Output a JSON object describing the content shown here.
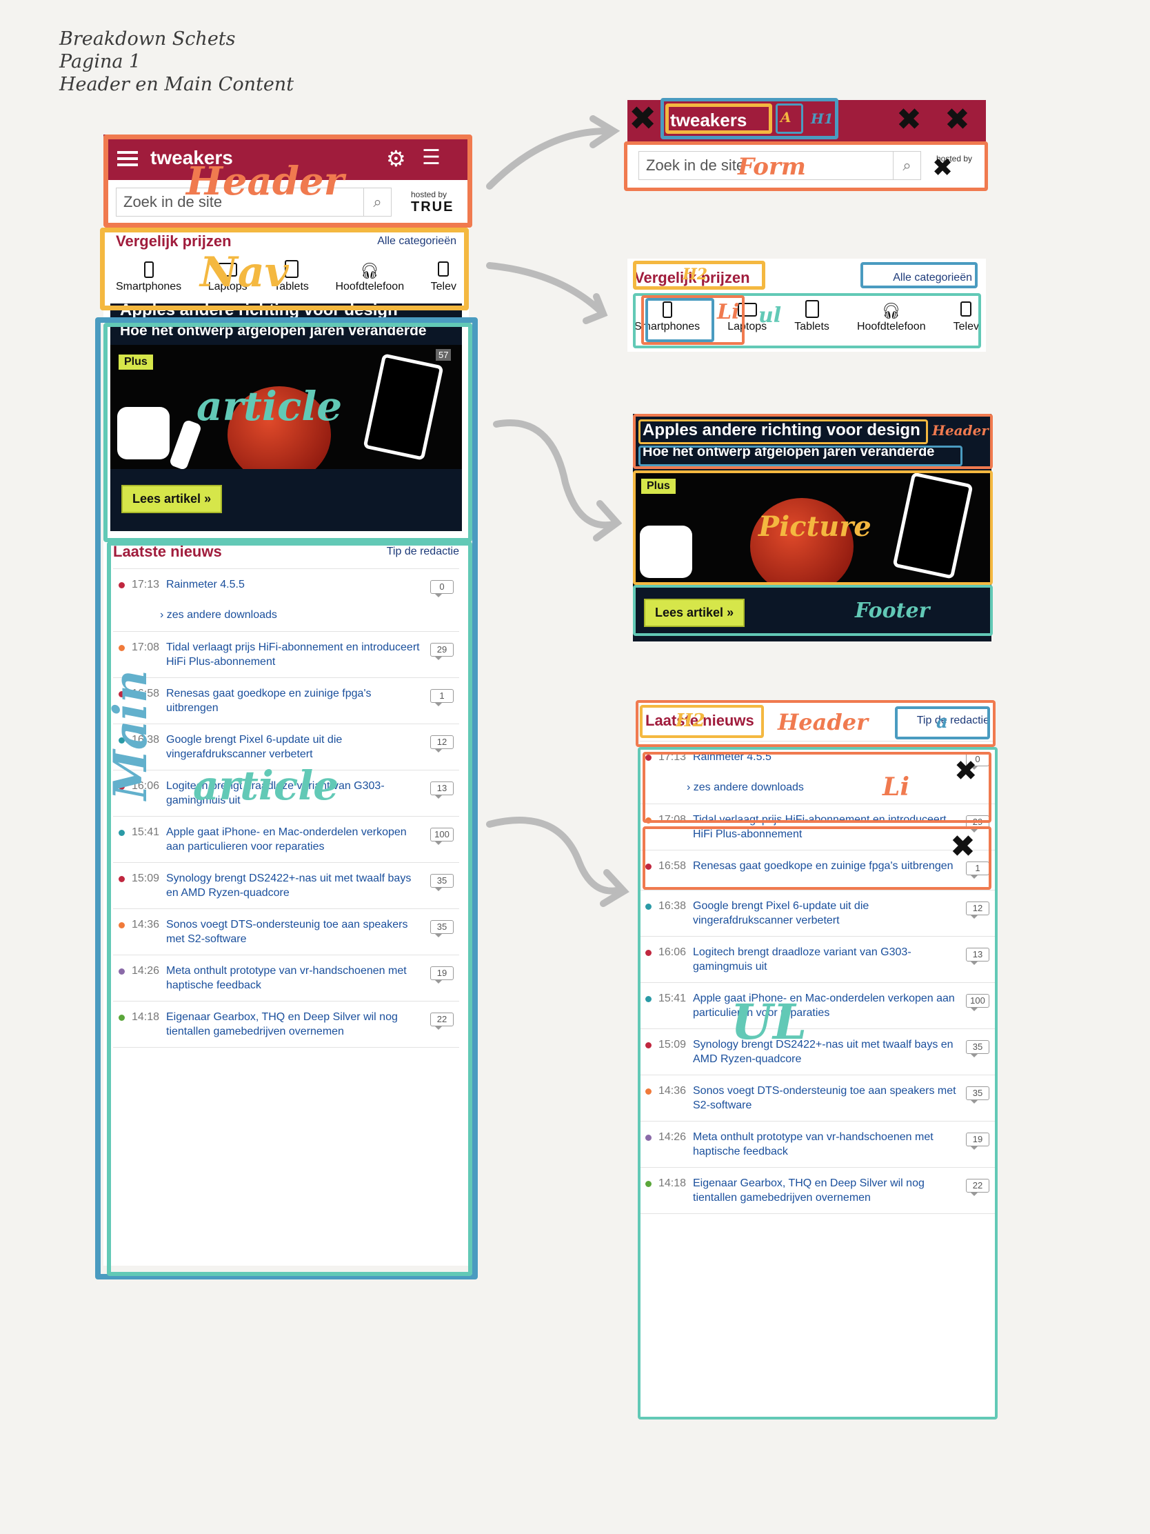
{
  "notes": {
    "line1": "Breakdown Schets",
    "line2": "Pagina 1",
    "line3": "Header en Main Content"
  },
  "site": {
    "logo": "tweakers",
    "search_placeholder": "Zoek in de site",
    "hosted_by": "hosted by",
    "host": "TRUE",
    "compare_title": "Vergelijk prijzen",
    "all_categories": "Alle categorieën",
    "categories": [
      "Smartphones",
      "Laptops",
      "Tablets",
      "Hoofdtelefoon",
      "Telev"
    ],
    "hero_title": "Apples andere richting voor design",
    "hero_subtitle": "Hoe het ontwerp afgelopen jaren veranderde",
    "plus_badge": "Plus",
    "hero_comments": "57",
    "read_button": "Lees artikel »",
    "news_title": "Laatste nieuws",
    "tip": "Tip de redactie",
    "more_downloads": "zes andere downloads",
    "news": [
      {
        "time": "17:13",
        "title": "Rainmeter 4.5.5",
        "count": "0",
        "color": "#c0273f"
      },
      {
        "time": "17:08",
        "title": "Tidal verlaagt prijs HiFi-abonnement en introduceert HiFi Plus-abonnement",
        "count": "29",
        "color": "#f07a3a"
      },
      {
        "time": "16:58",
        "title": "Renesas gaat goedkope en zuinige fpga's uitbrengen",
        "count": "1",
        "color": "#c0273f"
      },
      {
        "time": "16:38",
        "title": "Google brengt Pixel 6-update uit die vingerafdrukscanner verbetert",
        "count": "12",
        "color": "#2a9aa6"
      },
      {
        "time": "16:06",
        "title": "Logitech brengt draadloze variant van G303-gamingmuis uit",
        "count": "13",
        "color": "#c0273f"
      },
      {
        "time": "15:41",
        "title": "Apple gaat iPhone- en Mac-onderdelen verkopen aan particulieren voor reparaties",
        "count": "100",
        "color": "#2a9aa6"
      },
      {
        "time": "15:09",
        "title": "Synology brengt DS2422+-nas uit met twaalf bays en AMD Ryzen-quadcore",
        "count": "35",
        "color": "#c0273f"
      },
      {
        "time": "14:36",
        "title": "Sonos voegt DTS-ondersteunig toe aan speakers met S2-software",
        "count": "35",
        "color": "#f07a3a"
      },
      {
        "time": "14:26",
        "title": "Meta onthult prototype van vr-handschoenen met haptische feedback",
        "count": "19",
        "color": "#8a6aa8"
      },
      {
        "time": "14:18",
        "title": "Eigenaar Gearbox, THQ en Deep Silver wil nog tientallen gamebedrijven overnemen",
        "count": "22",
        "color": "#5aa63a"
      }
    ]
  },
  "annotations": {
    "header": "Header",
    "nav": "Nav",
    "article": "article",
    "main": "Main",
    "form": "Form",
    "h1": "H1",
    "a": "A",
    "h2": "H2",
    "li": "Li",
    "ul": "ul",
    "picture": "Picture",
    "footer": "Footer",
    "header2": "Header",
    "h2b": "H2",
    "tip_a": "a",
    "li2": "Li",
    "ul2": "UL"
  },
  "colors": {
    "brand": "#a01c3c",
    "link": "#1a4f9c",
    "orange": "#f07a4f",
    "yellow": "#f4b840",
    "teal": "#62c9b6",
    "blue": "#4a9bc0"
  }
}
